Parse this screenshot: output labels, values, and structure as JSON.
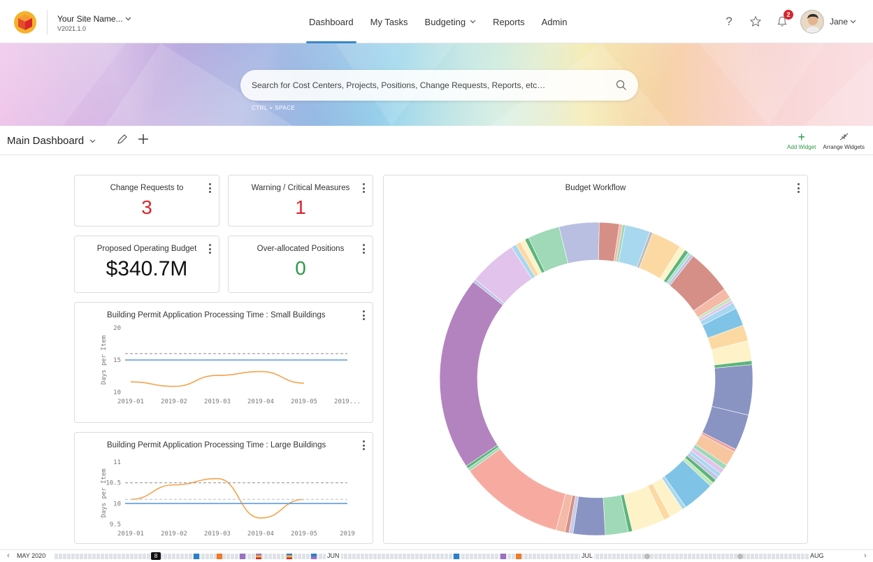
{
  "header": {
    "site_name": "Your Site Name...",
    "version": "V2021.1.0",
    "nav": [
      {
        "label": "Dashboard",
        "active": true
      },
      {
        "label": "My Tasks"
      },
      {
        "label": "Budgeting",
        "dropdown": true
      },
      {
        "label": "Reports"
      },
      {
        "label": "Admin"
      }
    ],
    "notification_count": "2",
    "user_name": "Jane",
    "icons": [
      "help-icon",
      "star-icon",
      "bell-icon",
      "avatar"
    ]
  },
  "search": {
    "placeholder": "Search for Cost Centers, Projects, Positions, Change Requests, Reports, etc…",
    "shortcut": "CTRL  +  SPACE"
  },
  "dashboard": {
    "title": "Main Dashboard",
    "add_widget": "Add Widget",
    "arrange_widgets": "Arrange Widgets"
  },
  "cards": {
    "change_requests": {
      "title": "Change Requests to",
      "value": "3"
    },
    "warning": {
      "title": "Warning / Critical Measures",
      "value": "1"
    },
    "proposed_budget": {
      "title": "Proposed Operating Budget",
      "value": "$340.7M"
    },
    "over_allocated": {
      "title": "Over-allocated Positions",
      "value": "0"
    },
    "small_buildings": {
      "title": "Building Permit Application Processing Time : Small Buildings"
    },
    "large_buildings": {
      "title": "Building Permit Application Processing Time : Large Buildings"
    },
    "budget_workflow": {
      "title": "Budget Workflow"
    }
  },
  "timeline": {
    "labels": [
      "MAY 2020",
      "JUN",
      "JUL",
      "AUG"
    ],
    "marker": "8"
  },
  "colors": {
    "accent": "#3a86c9",
    "red": "#d9262c",
    "green": "#2a9a45",
    "orange_line": "#f4a34b",
    "blue_line": "#5b9bd5"
  },
  "chart_data": [
    {
      "type": "line",
      "title": "Building Permit Application Processing Time : Small Buildings",
      "ylabel": "Days per Item",
      "x": [
        "2019-01",
        "2019-02",
        "2019-03",
        "2019-04",
        "2019-05",
        "2019..."
      ],
      "ylim": [
        10,
        20
      ],
      "yticks": [
        10,
        15,
        20
      ],
      "series": [
        {
          "values": [
            11.6,
            10.9,
            12.6,
            13.2,
            11.4
          ],
          "color": "#f4a34b"
        },
        {
          "values": [
            15,
            15,
            15,
            15,
            15,
            15
          ],
          "color": "#5b9bd5"
        },
        {
          "values": [
            16,
            16,
            16,
            16,
            16,
            16
          ],
          "color": "#999999",
          "dashed": true
        }
      ]
    },
    {
      "type": "line",
      "title": "Building Permit Application Processing Time : Large Buildings",
      "ylabel": "Days per Item",
      "x": [
        "2019-01",
        "2019-02",
        "2019-03",
        "2019-04",
        "2019-05",
        "2019"
      ],
      "ylim": [
        9.5,
        11
      ],
      "yticks": [
        9.5,
        10,
        10.5,
        11
      ],
      "series": [
        {
          "values": [
            10.1,
            10.45,
            10.6,
            9.65,
            10.1
          ],
          "color": "#f4a34b"
        },
        {
          "values": [
            10,
            10,
            10,
            10,
            10,
            10
          ],
          "color": "#5b9bd5"
        },
        {
          "values": [
            10.5,
            10.5,
            10.5,
            10.5,
            10.5,
            10.5
          ],
          "color": "#999999",
          "dashed": true
        },
        {
          "values": [
            10.1,
            10.1,
            10.1,
            10.1,
            10.1,
            10.1
          ],
          "color": "#cccccc",
          "dashed": true
        }
      ]
    },
    {
      "type": "pie",
      "title": "Budget Workflow",
      "donut": true,
      "values": [
        4,
        2,
        0.3,
        0.3,
        2.5,
        0.3,
        3,
        0.6,
        0.4,
        0.3,
        0.3,
        4.5,
        1,
        0.3,
        0.3,
        0.6,
        1.8,
        1.6,
        2,
        0.4,
        5,
        3.6,
        0.3,
        1.5,
        0.5,
        0.5,
        0.4,
        0.4,
        0.4,
        0.4,
        3.2,
        0.4,
        1.4,
        0.7,
        3.3,
        0.4,
        2.3,
        3.2,
        0.4,
        0.4,
        0.9,
        10.5,
        0.3,
        0.3,
        19.4,
        0.3,
        4.8,
        0.5,
        0.5,
        0.5,
        0.4,
        3.2
      ],
      "colors": [
        "#b9bfe0",
        "#d68f86",
        "#f4b9a7",
        "#9fd9b8",
        "#a8d8ef",
        "#bbbbbb",
        "#fcd9a3",
        "#fef2c8",
        "#5cb57b",
        "#a7e0c9",
        "#bfc4e6",
        "#d68f86",
        "#f4b9a7",
        "#c1e7b9",
        "#e2c3ec",
        "#a8d8ef",
        "#7fc3e6",
        "#fcd9a3",
        "#fef2c8",
        "#5cb57b",
        "#8994c3",
        "#8994c3",
        "#f2a09a",
        "#f7c69f",
        "#9fd9b8",
        "#e2c3ec",
        "#a8d8ef",
        "#bfc4e6",
        "#5cb57b",
        "#c1e7b9",
        "#7fc3e6",
        "#a8d8ef",
        "#fef2c8",
        "#fcd9a3",
        "#fef2c8",
        "#5cb57b",
        "#9fd9b8",
        "#8994c3",
        "#c6cce8",
        "#d68f86",
        "#f4b9a7",
        "#f7aba0",
        "#9fd9b8",
        "#5cb57b",
        "#b383bf",
        "#bfc4e6",
        "#e2c3ec",
        "#a8d8ef",
        "#fcd9a3",
        "#fef2c8",
        "#5cb57b",
        "#9fd9b8"
      ]
    }
  ]
}
